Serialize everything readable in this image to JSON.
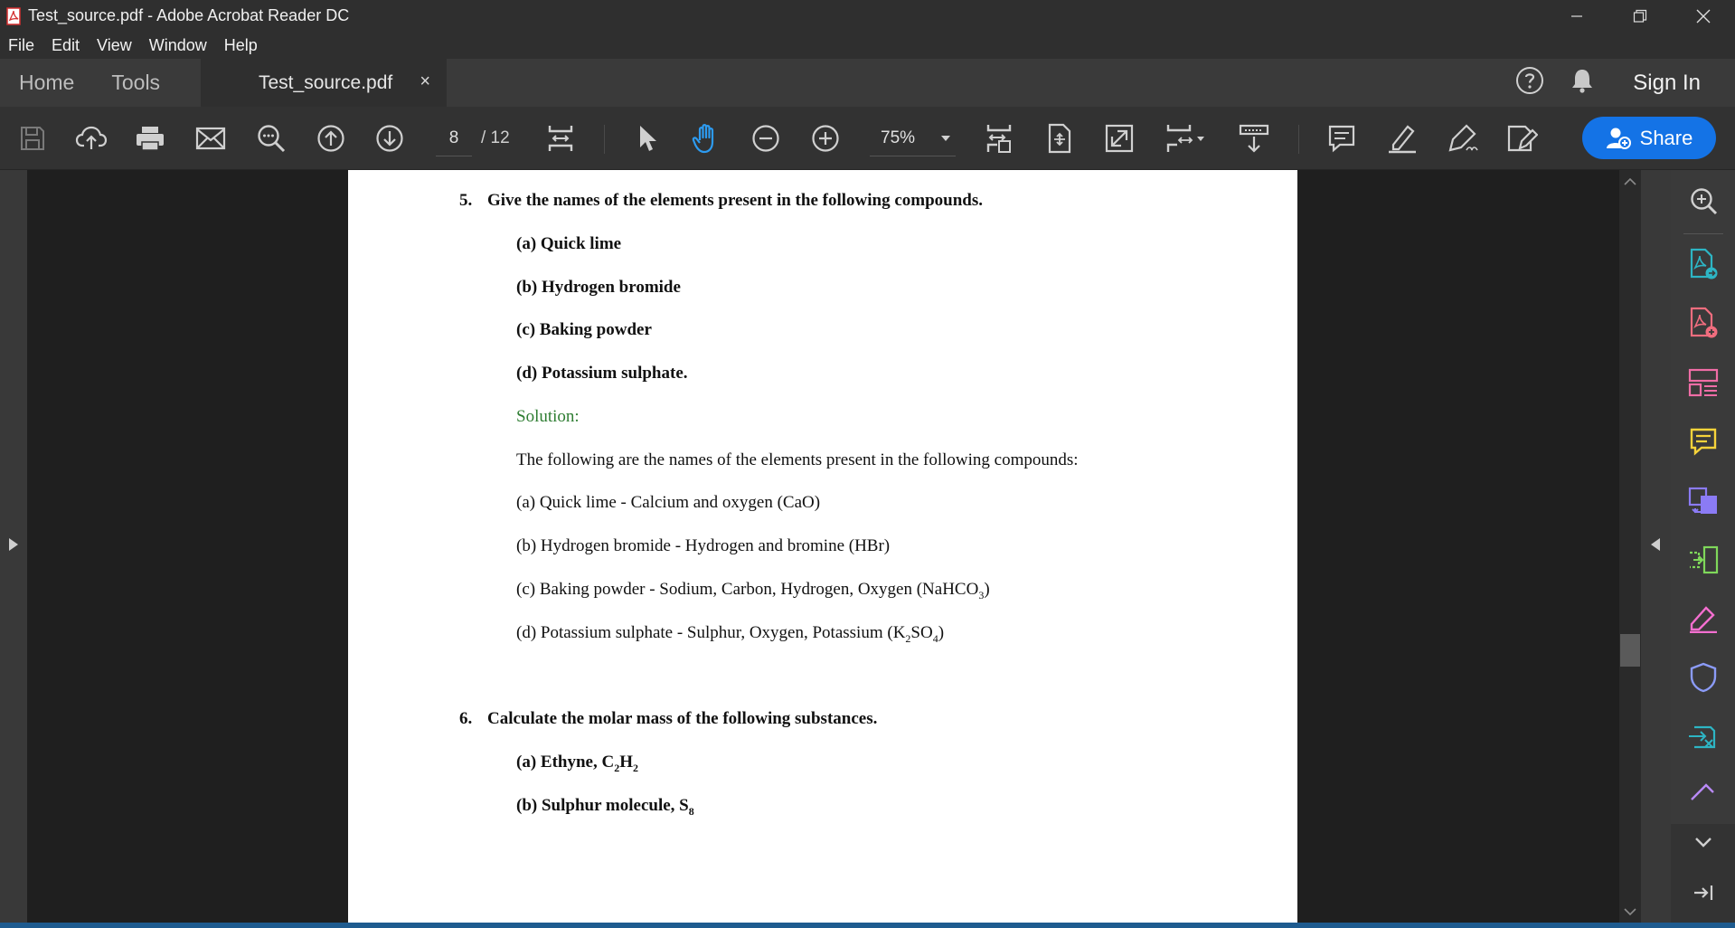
{
  "window": {
    "title": "Test_source.pdf - Adobe Acrobat Reader DC",
    "app_icon": "acrobat-logo-icon"
  },
  "menu": [
    "File",
    "Edit",
    "View",
    "Window",
    "Help"
  ],
  "tabs": {
    "home": "Home",
    "tools": "Tools",
    "document": "Test_source.pdf",
    "close_symbol": "×",
    "sign_in": "Sign In"
  },
  "toolbar": {
    "page_current": "8",
    "page_total": "/ 12",
    "zoom": "75%",
    "share_label": "Share"
  },
  "document": {
    "q5": {
      "number": "5.",
      "question": "Give the names of the elements present in the following compounds.",
      "parts": [
        "(a) Quick lime",
        "(b) Hydrogen bromide",
        "(c) Baking powder",
        "(d) Potassium sulphate."
      ],
      "solution_label": "Solution:",
      "intro": "The following are the names of the elements present in the following compounds:",
      "answers": {
        "a": "(a) Quick lime - Calcium and oxygen (CaO)",
        "b": "(b) Hydrogen bromide - Hydrogen and bromine (HBr)",
        "c_pre": "(c) Baking powder - Sodium, Carbon, Hydrogen, Oxygen (NaHCO",
        "c_sub": "3",
        "c_post": ")",
        "d_pre": "(d) Potassium sulphate - Sulphur, Oxygen, Potassium (K",
        "d_sub1": "2",
        "d_mid": "SO",
        "d_sub2": "4",
        "d_post": ")"
      }
    },
    "q6": {
      "number": "6.",
      "question": "Calculate the molar mass of the following substances.",
      "a_pre": "(a) Ethyne, C",
      "a_sub1": "2",
      "a_mid": "H",
      "a_sub2": "2",
      "b_pre": "(b) Sulphur molecule, S",
      "b_sub": "8"
    }
  },
  "colors": {
    "share_blue": "#1473e6",
    "solution_green": "#2e7d32",
    "statusbar_blue": "#1e5b8f"
  }
}
